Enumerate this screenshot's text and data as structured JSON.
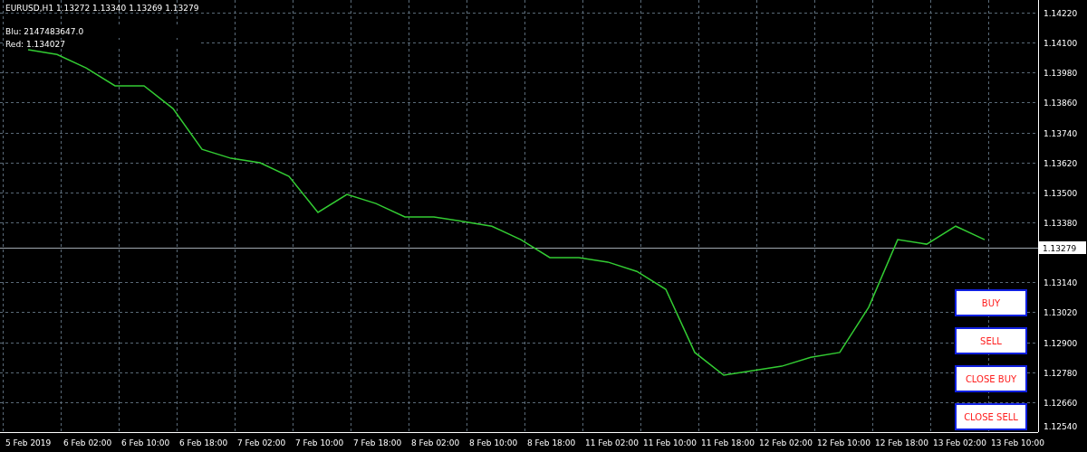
{
  "header": {
    "symbol_line": "EURUSD,H1  1.13272 1.13340 1.13269 1.13279",
    "indicator_lines": [
      "Blu: 2147483647.0",
      "Red: 1.134027"
    ]
  },
  "chart": {
    "chart_data": {
      "type": "line",
      "grid": true,
      "categories": [
        "5 Feb 2019",
        null,
        "6 Feb 02:00",
        null,
        "6 Feb 10:00",
        null,
        "6 Feb 18:00",
        null,
        "7 Feb 02:00",
        null,
        "7 Feb 10:00",
        null,
        "7 Feb 18:00",
        null,
        "8 Feb 02:00",
        null,
        "8 Feb 10:00",
        null,
        "8 Feb 18:00",
        null,
        "11 Feb 02:00",
        null,
        "11 Feb 10:00",
        null,
        "11 Feb 18:00",
        null,
        "12 Feb 02:00",
        null,
        "12 Feb 10:00",
        null,
        "12 Feb 18:00",
        null,
        "13 Feb 02:00",
        null,
        "13 Feb 10:00"
      ],
      "series": [
        {
          "color": "#33cc33",
          "values": [
            1.14072,
            1.14053,
            1.13999,
            1.13927,
            1.13927,
            1.13836,
            1.13673,
            1.13637,
            1.13619,
            1.13565,
            1.1342,
            1.13492,
            1.13456,
            1.13402,
            1.13402,
            1.13384,
            1.13365,
            1.13311,
            1.13239,
            1.13239,
            1.13221,
            1.13184,
            1.13112,
            1.12859,
            1.12768,
            1.12786,
            1.12804,
            1.1284,
            1.12859,
            1.1304,
            1.13311,
            1.13293,
            1.13365,
            1.13311,
            null
          ]
        }
      ],
      "ref_lines": [
        {
          "axis": "y",
          "value": 1.13279,
          "label": "1.13279",
          "color": "#a0a8b0"
        }
      ],
      "ylim": [
        1.1254,
        1.14271
      ],
      "yticks": [
        {
          "value": 1.1422,
          "label": "1.14220"
        },
        {
          "value": 1.141,
          "label": "1.14100"
        },
        {
          "value": 1.1398,
          "label": "1.13980"
        },
        {
          "value": 1.1386,
          "label": "1.13860"
        },
        {
          "value": 1.1374,
          "label": "1.13740"
        },
        {
          "value": 1.1362,
          "label": "1.13620"
        },
        {
          "value": 1.135,
          "label": "1.13500"
        },
        {
          "value": 1.1338,
          "label": "1.13380"
        },
        {
          "value": 1.1314,
          "label": "1.13140"
        },
        {
          "value": 1.1302,
          "label": "1.13020"
        },
        {
          "value": 1.129,
          "label": "1.12900"
        },
        {
          "value": 1.1278,
          "label": "1.12780"
        },
        {
          "value": 1.1266,
          "label": "1.12660"
        },
        {
          "value": 1.1254,
          "label": "1.12540"
        }
      ]
    }
  },
  "buttons": [
    "BUY",
    "SELL",
    "CLOSE BUY",
    "CLOSE SELL"
  ]
}
